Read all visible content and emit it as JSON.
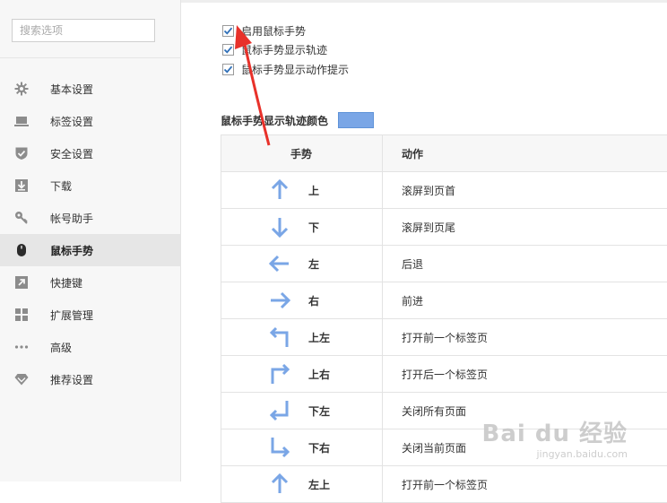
{
  "search": {
    "placeholder": "搜索选项"
  },
  "sidebar": {
    "items": [
      {
        "label": "基本设置",
        "icon": "gear-icon",
        "active": false
      },
      {
        "label": "标签设置",
        "icon": "laptop-icon",
        "active": false
      },
      {
        "label": "安全设置",
        "icon": "shield-icon",
        "active": false
      },
      {
        "label": "下载",
        "icon": "download-icon",
        "active": false
      },
      {
        "label": "帐号助手",
        "icon": "key-icon",
        "active": false
      },
      {
        "label": "鼠标手势",
        "icon": "mouse-icon",
        "active": true
      },
      {
        "label": "快捷键",
        "icon": "shortcut-arrow-icon",
        "active": false
      },
      {
        "label": "扩展管理",
        "icon": "grid-icon",
        "active": false
      },
      {
        "label": "高级",
        "icon": "more-dots-icon",
        "active": false
      },
      {
        "label": "推荐设置",
        "icon": "diamond-icon",
        "active": false
      }
    ]
  },
  "options": {
    "enable_gesture": {
      "label": "启用鼠标手势",
      "checked": true
    },
    "show_trail": {
      "label": "鼠标手势显示轨迹",
      "checked": true
    },
    "show_action_hint": {
      "label": "鼠标手势显示动作提示",
      "checked": true
    }
  },
  "trail_color": {
    "label": "鼠标手势显示轨迹颜色",
    "value": "#7aa6e6"
  },
  "colors": {
    "accent": "#7aa6e6",
    "checkmark": "#2f6fb8",
    "annotation": "#e8312a"
  },
  "table": {
    "headers": {
      "gesture": "手势",
      "action": "动作"
    },
    "rows": [
      {
        "icon": "arrow-up-icon",
        "gesture": "上",
        "action": "滚屏到页首"
      },
      {
        "icon": "arrow-down-icon",
        "gesture": "下",
        "action": "滚屏到页尾"
      },
      {
        "icon": "arrow-left-icon",
        "gesture": "左",
        "action": "后退"
      },
      {
        "icon": "arrow-right-icon",
        "gesture": "右",
        "action": "前进"
      },
      {
        "icon": "arrow-up-left-icon",
        "gesture": "上左",
        "action": "打开前一个标签页"
      },
      {
        "icon": "arrow-up-right-icon",
        "gesture": "上右",
        "action": "打开后一个标签页"
      },
      {
        "icon": "arrow-down-left-icon",
        "gesture": "下左",
        "action": "关闭所有页面"
      },
      {
        "icon": "arrow-down-right-icon",
        "gesture": "下右",
        "action": "关闭当前页面"
      },
      {
        "icon": "arrow-up-icon",
        "gesture": "左上",
        "action": "打开前一个标签页"
      }
    ]
  },
  "watermark": {
    "brand": "Bai du 经验",
    "url": "jingyan.baidu.com"
  }
}
